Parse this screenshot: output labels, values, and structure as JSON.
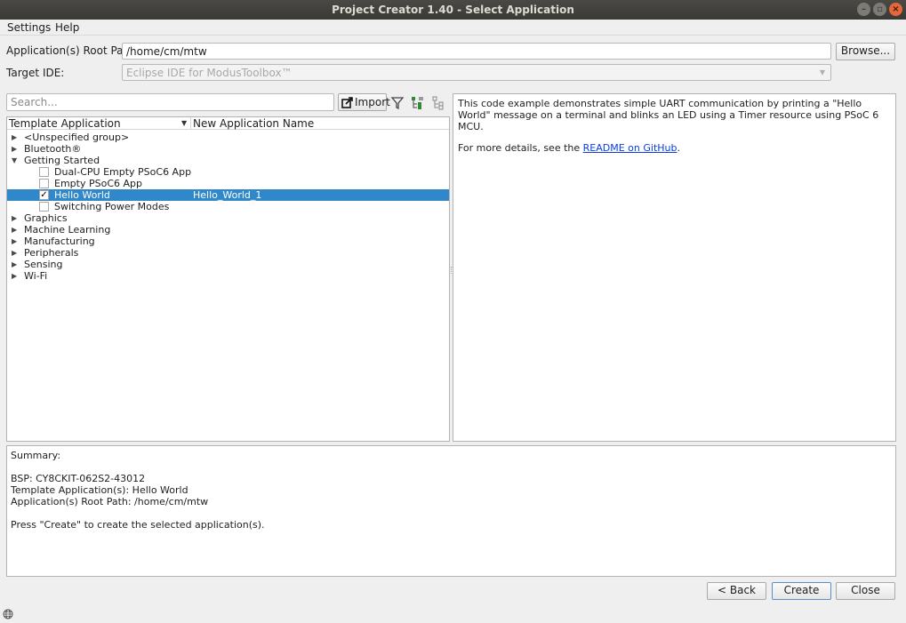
{
  "window": {
    "title": "Project Creator 1.40 - Select Application"
  },
  "menu": {
    "settings": "Settings",
    "help": "Help"
  },
  "form": {
    "root_path_label": "Application(s) Root Path:",
    "root_path_value": "/home/cm/mtw",
    "browse_label": "Browse...",
    "target_ide_label": "Target IDE:",
    "target_ide_value": "Eclipse IDE for ModusToolbox™"
  },
  "toolbar": {
    "search_placeholder": "Search...",
    "import_label": "Import"
  },
  "tree": {
    "columns": [
      "Template Application",
      "New Application Name"
    ],
    "groups_top": [
      {
        "label": "<Unspecified group>"
      },
      {
        "label": "Bluetooth®"
      }
    ],
    "expanded_group": {
      "label": "Getting Started",
      "children": [
        {
          "label": "Dual-CPU Empty PSoC6 App",
          "checked": false,
          "new_name": ""
        },
        {
          "label": "Empty PSoC6 App",
          "checked": false,
          "new_name": ""
        },
        {
          "label": "Hello World",
          "checked": true,
          "new_name": "Hello_World_1"
        },
        {
          "label": "Switching Power Modes",
          "checked": false,
          "new_name": ""
        }
      ]
    },
    "groups_bottom": [
      {
        "label": "Graphics"
      },
      {
        "label": "Machine Learning"
      },
      {
        "label": "Manufacturing"
      },
      {
        "label": "Peripherals"
      },
      {
        "label": "Sensing"
      },
      {
        "label": "Wi-Fi"
      }
    ]
  },
  "description": {
    "text": "This code example demonstrates simple UART communication by printing a \"Hello World\" message on a terminal and blinks an LED using a Timer resource using PSoC 6 MCU.",
    "details_prefix": "For more details, see the ",
    "link_text": "README on GitHub",
    "details_suffix": "."
  },
  "summary": {
    "heading": "Summary:",
    "bsp": "BSP: CY8CKIT-062S2-43012",
    "templates": "Template Application(s): Hello World",
    "root_path": "Application(s) Root Path: /home/cm/mtw",
    "instruction": "Press \"Create\" to create the selected application(s)."
  },
  "buttons": {
    "back": "< Back",
    "create": "Create",
    "close": "Close"
  }
}
